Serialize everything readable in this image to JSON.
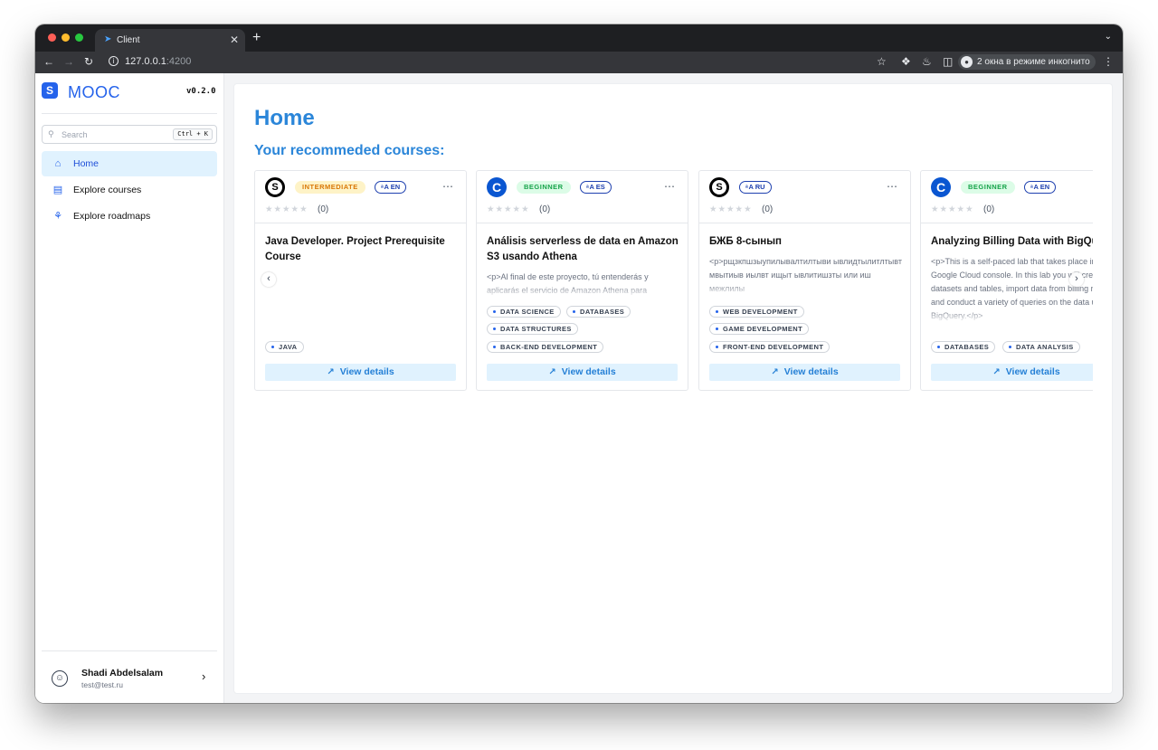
{
  "browser": {
    "tab_title": "Client",
    "tab_favicon": "angular-icon",
    "url_host": "127.0.0.1",
    "url_port": ":4200",
    "incognito_label": "2 окна в режиме инкогнито"
  },
  "sidebar": {
    "brand": "MOOC",
    "version": "v0.2.0",
    "search_placeholder": "Search",
    "search_shortcut": "Ctrl + K",
    "items": [
      {
        "label": "Home",
        "icon": "home-icon",
        "active": true
      },
      {
        "label": "Explore courses",
        "icon": "courses-icon",
        "active": false
      },
      {
        "label": "Explore roadmaps",
        "icon": "roadmap-icon",
        "active": false
      }
    ],
    "user": {
      "name": "Shadi Abdelsalam",
      "email": "test@test.ru"
    }
  },
  "main": {
    "title": "Home",
    "section_title": "Your recommeded courses:",
    "view_details_label": "View details",
    "courses": [
      {
        "provider": "udemy",
        "level": "INTERMEDIATE",
        "language": "EN",
        "rating_count": "(0)",
        "title": "Java Developer. Project Prerequisite Course",
        "description": "",
        "tags": [
          "JAVA"
        ]
      },
      {
        "provider": "coursera",
        "level": "BEGINNER",
        "language": "ES",
        "rating_count": "(0)",
        "title": "Análisis serverless de data en Amazon S3 usando Athena",
        "description": "<p>Al final de este proyecto, tú entenderás y aplicarás el servicio de Amazon Athena para",
        "tags": [
          "DATA SCIENCE",
          "DATABASES",
          "DATA STRUCTURES",
          "BACK-END DEVELOPMENT"
        ]
      },
      {
        "provider": "udemy",
        "level": "",
        "language": "RU",
        "rating_count": "(0)",
        "title": "БЖБ 8-сынып",
        "description": "<p>рщзкпшзыупилывалтилтыви ывлидтылитлтывт мвытиыв иылвт ищыт ывлитишзты или иш межлилы",
        "tags": [
          "WEB DEVELOPMENT",
          "GAME DEVELOPMENT",
          "FRONT-END DEVELOPMENT"
        ]
      },
      {
        "provider": "coursera",
        "level": "BEGINNER",
        "language": "EN",
        "rating_count": "(0)",
        "title": "Analyzing Billing Data with BigQuery",
        "description": "<p>This is a self-paced lab that takes place in the Google Cloud console. In this lab you will create datasets and tables, import data from billing reports, and conduct a variety of queries on the data using BigQuery.</p>",
        "tags": [
          "DATABASES",
          "DATA ANALYSIS"
        ]
      }
    ]
  },
  "colors": {
    "accent": "#2b86d9",
    "brand": "#2563eb",
    "intermediate_bg": "#fef3c7",
    "intermediate_fg": "#d97706",
    "beginner_bg": "#dcfce7",
    "beginner_fg": "#16a34a"
  }
}
